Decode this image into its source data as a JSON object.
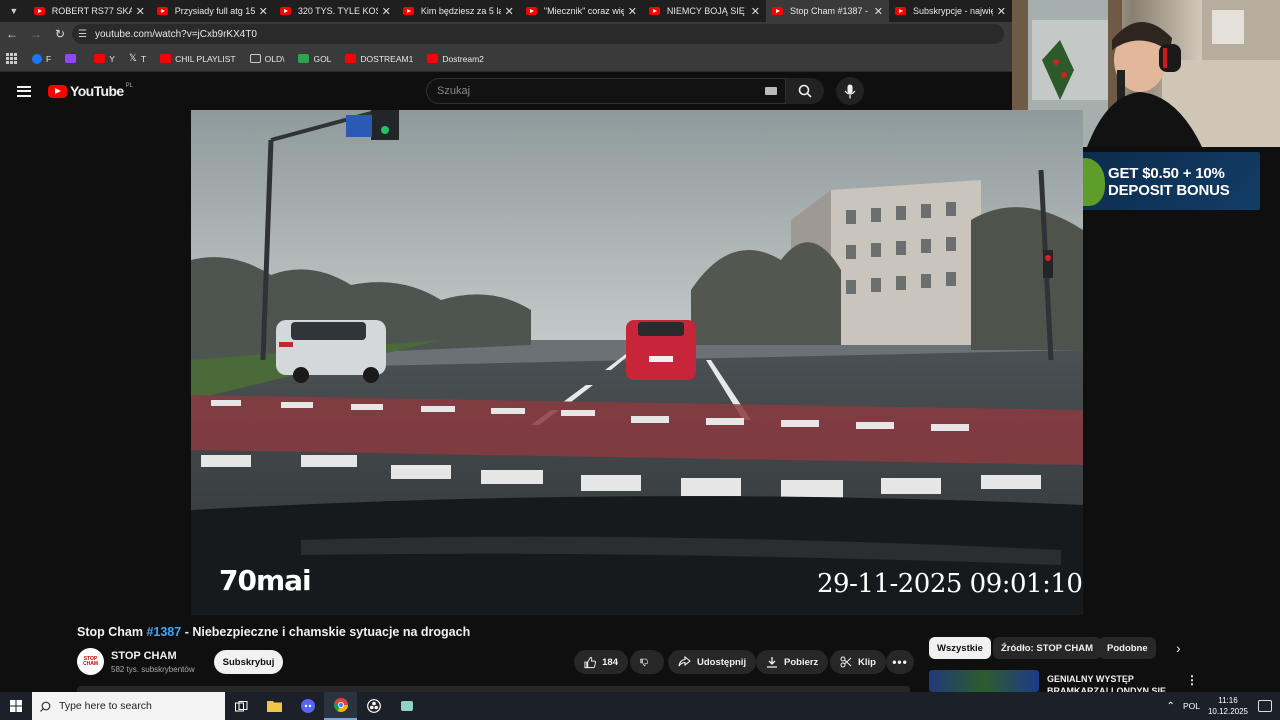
{
  "browser": {
    "tabs": [
      {
        "label": "ROBERT RS77 SKAZA",
        "active": false
      },
      {
        "label": "Przysiady full atg 15 …",
        "active": false
      },
      {
        "label": "320 TYS. TYLE KOSZT",
        "active": false
      },
      {
        "label": "Kim będziesz za 5 lat",
        "active": false
      },
      {
        "label": "\"Miecznik\" coraz wię",
        "active": false
      },
      {
        "label": "NIEMCY BOJĄ SIĘ ŚW",
        "active": false
      },
      {
        "label": "Stop Cham #1387 - N",
        "active": true
      },
      {
        "label": "Subskrypcje - najwię",
        "active": false
      }
    ],
    "url": "youtube.com/watch?v=jCxb9rKX4T0",
    "bookmarks": [
      {
        "label": "F",
        "color": "#1877f2"
      },
      {
        "label": "",
        "color": "#9146ff"
      },
      {
        "label": "Y",
        "color": "#ff0000"
      },
      {
        "label": "T",
        "color": "#000000"
      },
      {
        "label": "CHIL PLAYLIST",
        "color": "#ff0000"
      },
      {
        "label": "OLD\\",
        "color": "folder"
      },
      {
        "label": "GOL",
        "color": "#2ea44f"
      },
      {
        "label": "DOSTREAM1",
        "color": "#ff0000"
      },
      {
        "label": "Dostream2",
        "color": "#ff0000"
      }
    ]
  },
  "youtube": {
    "logo_text": "YouTube",
    "region": "PL",
    "search_placeholder": "Szukaj"
  },
  "ad": {
    "line1": "GET $0.50 + 10%",
    "line2": "DEPOSIT BONUS"
  },
  "video": {
    "watermark": "70mai",
    "timestamp": "29-11-2025 09:01:10",
    "title_prefix": "Stop Cham ",
    "title_tag": "#1387",
    "title_suffix": " - Niebezpieczne i chamskie sytuacje na drogach"
  },
  "channel": {
    "avatar_text": "STOP CHAM",
    "name": "STOP CHAM",
    "subscribers": "582 tys. subskrybentów",
    "subscribe_label": "Subskrybuj"
  },
  "actions": {
    "likes": "184",
    "share": "Udostępnij",
    "download": "Pobierz",
    "clip": "Klip"
  },
  "related": {
    "chips": [
      "Wszystkie",
      "Źródło: STOP CHAM",
      "Podobne"
    ],
    "first_title": "GENIALNY WYSTĘP BRAMKARZA! LONDYN SIE"
  },
  "taskbar": {
    "search_placeholder": "Type here to search",
    "language": "POL",
    "time": "11:16",
    "date": "10.12.2025"
  }
}
